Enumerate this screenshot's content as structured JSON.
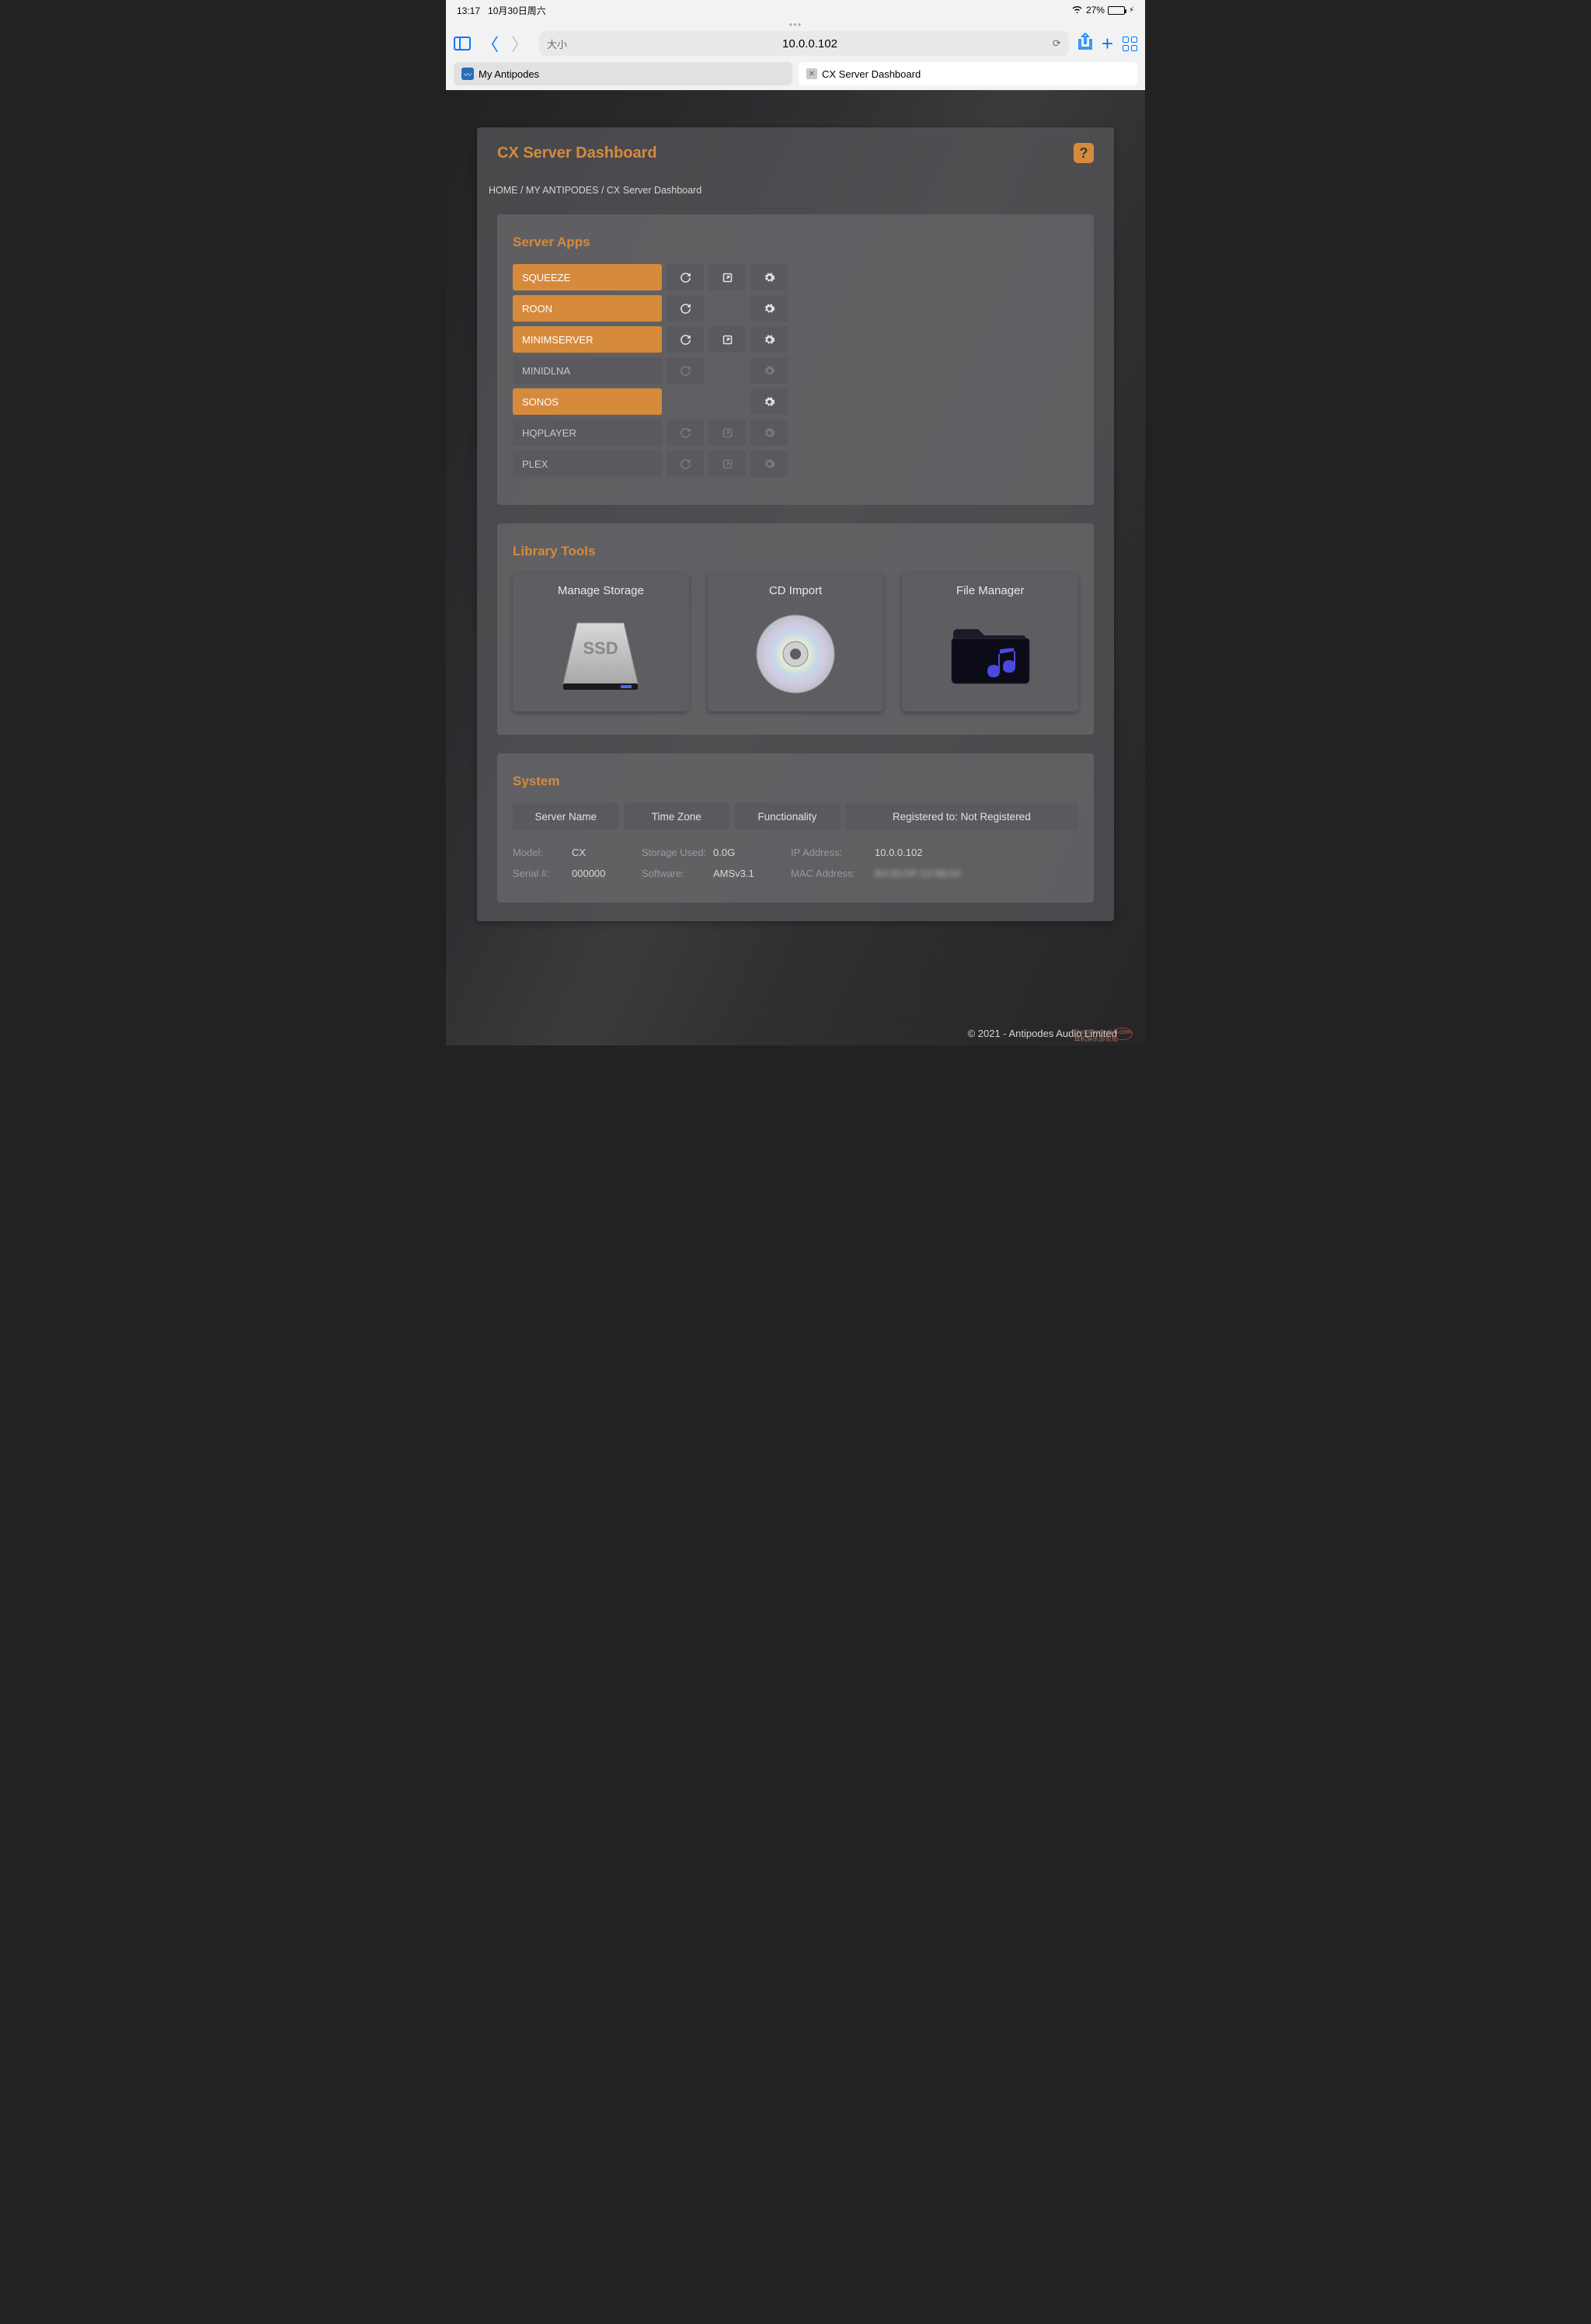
{
  "statusbar": {
    "time": "13:17",
    "date": "10月30日周六",
    "battery_pct": "27%"
  },
  "browser": {
    "aa_label": "大小",
    "url": "10.0.0.102",
    "tabs": [
      {
        "label": "My Antipodes",
        "active": false
      },
      {
        "label": "CX Server Dashboard",
        "active": true
      }
    ]
  },
  "header": {
    "title": "CX Server Dashboard"
  },
  "breadcrumb": {
    "home": "HOME",
    "my": "MY ANTIPODES",
    "current": "CX Server Dashboard"
  },
  "server_apps": {
    "title": "Server Apps",
    "rows": [
      {
        "name": "SQUEEZE",
        "active": true,
        "refresh": true,
        "open": true,
        "gear": true
      },
      {
        "name": "ROON",
        "active": true,
        "refresh": true,
        "open": false,
        "gear": true
      },
      {
        "name": "MINIMSERVER",
        "active": true,
        "refresh": true,
        "open": true,
        "gear": true
      },
      {
        "name": "MINIDLNA",
        "active": false,
        "refresh": false,
        "open": false,
        "gear": false
      },
      {
        "name": "SONOS",
        "active": true,
        "refresh": false,
        "open": false,
        "gear": true
      },
      {
        "name": "HQPLAYER",
        "active": false,
        "refresh": false,
        "open": false,
        "gear": false
      },
      {
        "name": "PLEX",
        "active": false,
        "refresh": false,
        "open": false,
        "gear": false
      }
    ]
  },
  "library_tools": {
    "title": "Library Tools",
    "tools": [
      {
        "label": "Manage Storage"
      },
      {
        "label": "CD Import"
      },
      {
        "label": "File Manager"
      }
    ]
  },
  "system": {
    "title": "System",
    "buttons": {
      "server_name": "Server Name",
      "time_zone": "Time Zone",
      "functionality": "Functionality",
      "registered": "Registered to: Not Registered"
    },
    "info": {
      "model_label": "Model:",
      "model_val": "CX",
      "storage_label": "Storage Used:",
      "storage_val": "0.0G",
      "ip_label": "IP Address:",
      "ip_val": "10.0.0.102",
      "serial_label": "Serial #:",
      "serial_val": "000000",
      "software_label": "Software:",
      "software_val": "AMSv3.1",
      "mac_label": "MAC Address:",
      "mac_val": "B4:50:DF:13:9B:04"
    }
  },
  "footer": "© 2021 - Antipodes Audio Limited",
  "watermark": {
    "l1": "Headphoneclub.com",
    "l2": "耳机俱乐部论坛"
  }
}
